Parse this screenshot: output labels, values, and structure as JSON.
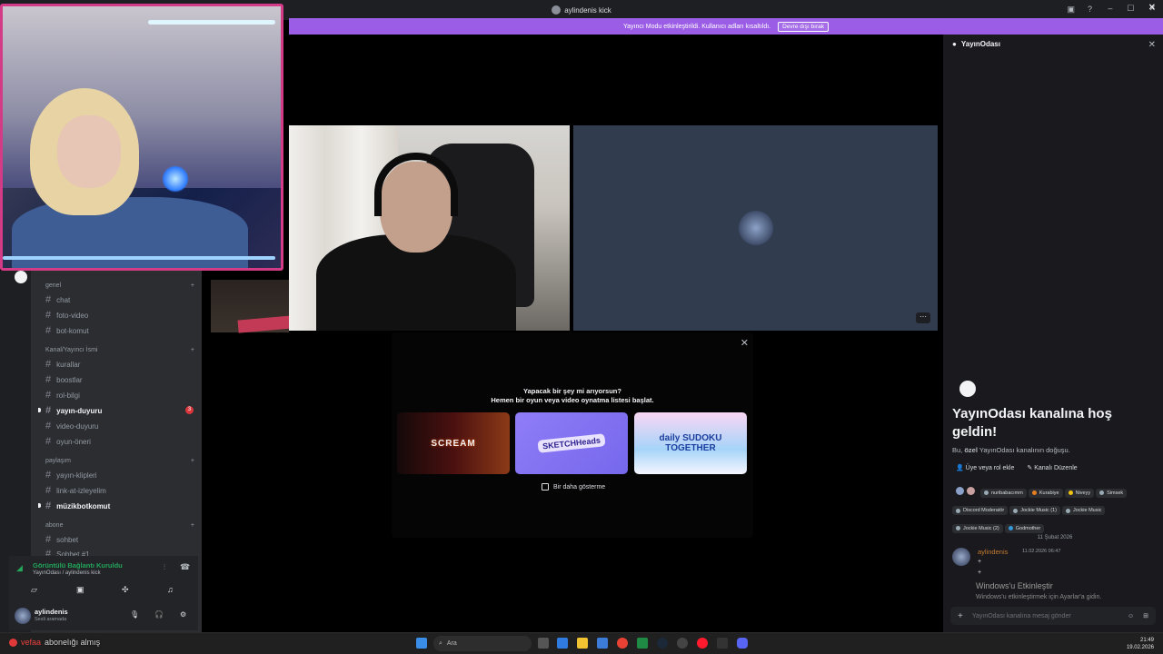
{
  "window": {
    "title": "aylindenis kick"
  },
  "banner": {
    "text": "Yayıncı Modu etkinleştirildi. Kullanıcı adları kısaltıldı.",
    "button": "Devre dışı bırak"
  },
  "sidebar": {
    "categories": [
      {
        "name": "genel",
        "channels": [
          "chat",
          "foto-video",
          "bot-komut"
        ]
      },
      {
        "name": "Kanal/Yayıncı İsmi",
        "channels": [
          "kurallar",
          "boostlar",
          "rol-bilgi",
          "yayın-duyuru",
          "video-duyuru",
          "oyun-öneri"
        ]
      },
      {
        "name": "paylaşım",
        "channels": [
          "yayın-klipleri",
          "link-at-izleyelim",
          "müzikbotkomut"
        ]
      },
      {
        "name": "abone",
        "channels": [
          "sohbet",
          "Sohbet #1"
        ]
      }
    ],
    "yayin_duyuru_badge": "3"
  },
  "voice": {
    "status": "Görüntülü Bağlantı Kuruldu",
    "location": "YayınOdası / aylindenis kick"
  },
  "user": {
    "name": "aylindenis",
    "status": "Sesli aramada"
  },
  "activity": {
    "line1": "Yapacak bir şey mi arıyorsun?",
    "line2": "Hemen bir oyun veya video oynatma listesi başlat.",
    "games": [
      "SCREAM",
      "SKETCHHeads",
      "daily SUDOKU TOGETHER"
    ],
    "dont_show": "Bir daha gösterme"
  },
  "tile2": {
    "more": "⋯"
  },
  "right_panel": {
    "header": "YayınOdası",
    "welcome_title": "YayınOdası kanalına hoş geldin!",
    "welcome_sub_prefix": "Bu, ",
    "welcome_sub_bold": "özel",
    "welcome_sub_suffix": " YayınOdası kanalının doğuşu.",
    "action_add": "Üye veya rol ekle",
    "action_edit": "Kanalı Düzenle",
    "roles": [
      {
        "name": "nuribabacımm",
        "color": "#99aab5"
      },
      {
        "name": "Kurabiye",
        "color": "#e67e22"
      },
      {
        "name": "Niveyy",
        "color": "#f1c40f"
      },
      {
        "name": "Simsek",
        "color": "#99aab5"
      },
      {
        "name": "Discord Moderatör",
        "color": "#99aab5"
      },
      {
        "name": "Jockie Music (1)",
        "color": "#99aab5"
      },
      {
        "name": "Jockie Music",
        "color": "#99aab5"
      },
      {
        "name": "Jockie Music (2)",
        "color": "#99aab5"
      },
      {
        "name": "Godmother",
        "color": "#3498db"
      }
    ],
    "date_divider": "11 Şubat 2026",
    "message": {
      "author": "aylindenis",
      "time": "11.02.2026 06:47",
      "lines": [
        "+",
        "+"
      ]
    },
    "watermark_title": "Windows'u Etkinleştir",
    "watermark_sub": "Windows'u etkinleştirmek için Ayarlar'a gidin.",
    "input_placeholder": "YayınOdası kanalına mesaj gönder"
  },
  "taskbar": {
    "search": "Ara",
    "time": "21:49",
    "date": "19.02.2026",
    "toast_prefix": "abonelığı almış",
    "toast_name": "vefaa"
  }
}
